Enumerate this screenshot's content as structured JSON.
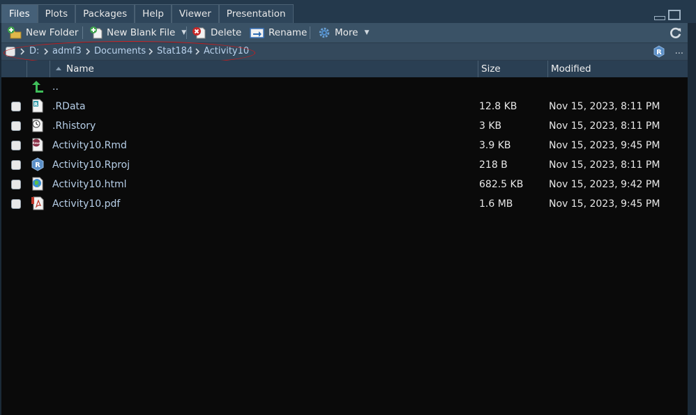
{
  "tabs": [
    "Files",
    "Plots",
    "Packages",
    "Help",
    "Viewer",
    "Presentation"
  ],
  "toolbar": {
    "new_folder": "New Folder",
    "new_blank_file": "New Blank File",
    "delete": "Delete",
    "rename": "Rename",
    "more": "More"
  },
  "path": [
    "D:",
    "admf3",
    "Documents",
    "Stat184",
    "Activity10"
  ],
  "path_more": "...",
  "columns": {
    "name": "Name",
    "size": "Size",
    "modified": "Modified"
  },
  "parent_dir": "..",
  "files": [
    {
      "name": ".RData",
      "size": "12.8 KB",
      "modified": "Nov 15, 2023, 8:11 PM",
      "icon": "rdata-icon"
    },
    {
      "name": ".Rhistory",
      "size": "3 KB",
      "modified": "Nov 15, 2023, 8:11 PM",
      "icon": "rhistory-icon"
    },
    {
      "name": "Activity10.Rmd",
      "size": "3.9 KB",
      "modified": "Nov 15, 2023, 9:45 PM",
      "icon": "rmd-icon"
    },
    {
      "name": "Activity10.Rproj",
      "size": "218 B",
      "modified": "Nov 15, 2023, 8:11 PM",
      "icon": "rproj-icon"
    },
    {
      "name": "Activity10.html",
      "size": "682.5 KB",
      "modified": "Nov 15, 2023, 9:42 PM",
      "icon": "html-icon"
    },
    {
      "name": "Activity10.pdf",
      "size": "1.6 MB",
      "modified": "Nov 15, 2023, 9:45 PM",
      "icon": "pdf-icon"
    }
  ],
  "colors": {
    "accent_link": "#b7cfe8",
    "annotation_oval": "#c91d1d",
    "list_background": "#0a0a0a"
  }
}
